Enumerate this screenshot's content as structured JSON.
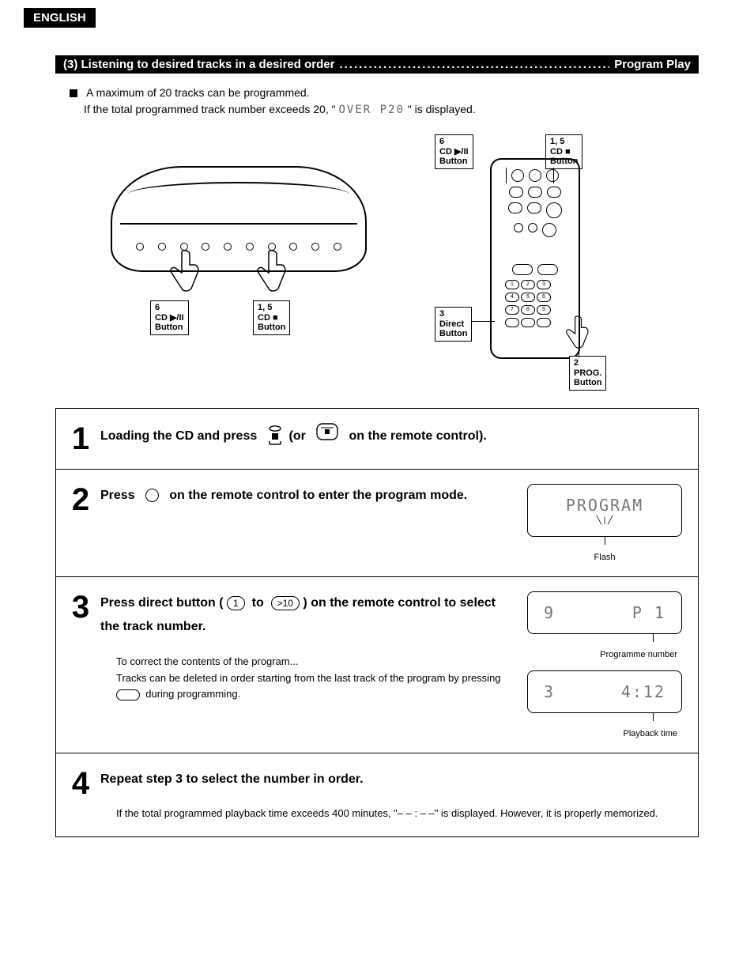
{
  "header": {
    "language_tab": "ENGLISH"
  },
  "section": {
    "title_prefix": "(3) Listening to desired tracks in a desired order",
    "title_suffix": "Program Play"
  },
  "intro": {
    "line1": "A maximum of 20 tracks can be programmed.",
    "line2_a": "If the total programmed track number exceeds 20, \"",
    "line2_lcd": "OVER  P20",
    "line2_b": "\" is displayed."
  },
  "callouts": {
    "unit_left": {
      "steps": "6",
      "label": "CD ▶/II",
      "sub": "Button"
    },
    "unit_right": {
      "steps": "1, 5",
      "label": "CD ■",
      "sub": "Button"
    },
    "remote_top_left": {
      "steps": "6",
      "label": "CD ▶/II",
      "sub": "Button"
    },
    "remote_top_right": {
      "steps": "1, 5",
      "label": "CD ■",
      "sub": "Button"
    },
    "remote_mid_left": {
      "steps": "3",
      "label": "Direct",
      "sub": "Button"
    },
    "remote_bottom_right": {
      "steps": "2",
      "label": "PROG.",
      "sub": "Button"
    }
  },
  "steps": {
    "s1": {
      "num": "1",
      "text_a": "Loading the CD and press",
      "text_b": "(or",
      "text_c": "on the remote control)."
    },
    "s2": {
      "num": "2",
      "text_a": "Press",
      "text_b": "on the remote control to enter the program mode.",
      "display": "PROGRAM",
      "display_sub": "Flash"
    },
    "s3": {
      "num": "3",
      "text_a": "Press direct button (",
      "btn1": "1",
      "text_to": "to",
      "btn10": ">10",
      "text_b": ") on the remote control to select the track number.",
      "note_title": "To correct the contents of the program...",
      "note_a": "Tracks can be deleted in order starting from the last track of the program by pressing",
      "note_b": "during programming.",
      "display1_left": "9",
      "display1_right": "P  1",
      "display1_sub": "Programme number",
      "display2_left": "3",
      "display2_right": "4:12",
      "display2_sub": "Playback time"
    },
    "s4": {
      "num": "4",
      "text": "Repeat step 3 to select the number in order.",
      "note": "If the total programmed playback time exceeds 400 minutes, \"– – : – –\" is displayed. However, it is properly memorized."
    }
  }
}
